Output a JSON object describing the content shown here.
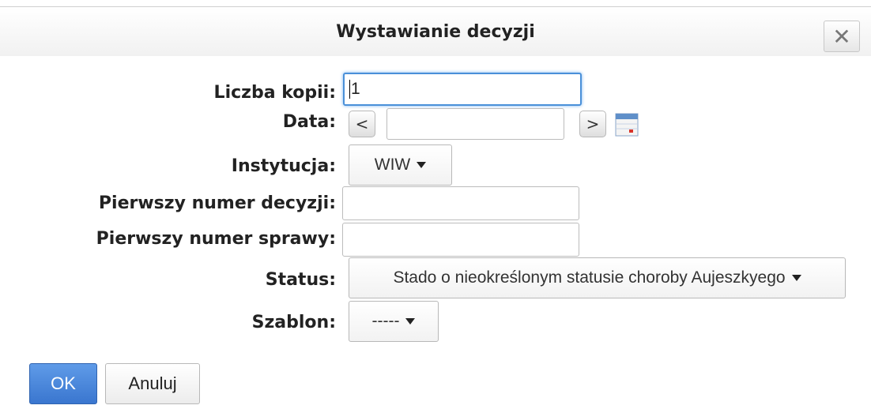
{
  "dialog": {
    "title": "Wystawianie decyzji",
    "close_icon": "close-icon"
  },
  "form": {
    "copies_label": "Liczba kopii:",
    "copies_value": "1",
    "date_label": "Data:",
    "date_value": "",
    "date_prev": "<",
    "date_next": ">",
    "calendar_icon": "calendar-icon",
    "institution_label": "Instytucja:",
    "institution_value": "WIW",
    "decision_number_label": "Pierwszy numer decyzji:",
    "decision_number_value": "",
    "case_number_label": "Pierwszy numer sprawy:",
    "case_number_value": "",
    "status_label": "Status:",
    "status_value": "Stado o nieokreślonym statusie choroby Aujeszkyego",
    "template_label": "Szablon:",
    "template_value": "-----"
  },
  "buttons": {
    "ok": "OK",
    "cancel": "Anuluj"
  },
  "colors": {
    "accent": "#3a76cf",
    "focus": "#4a90d9"
  }
}
